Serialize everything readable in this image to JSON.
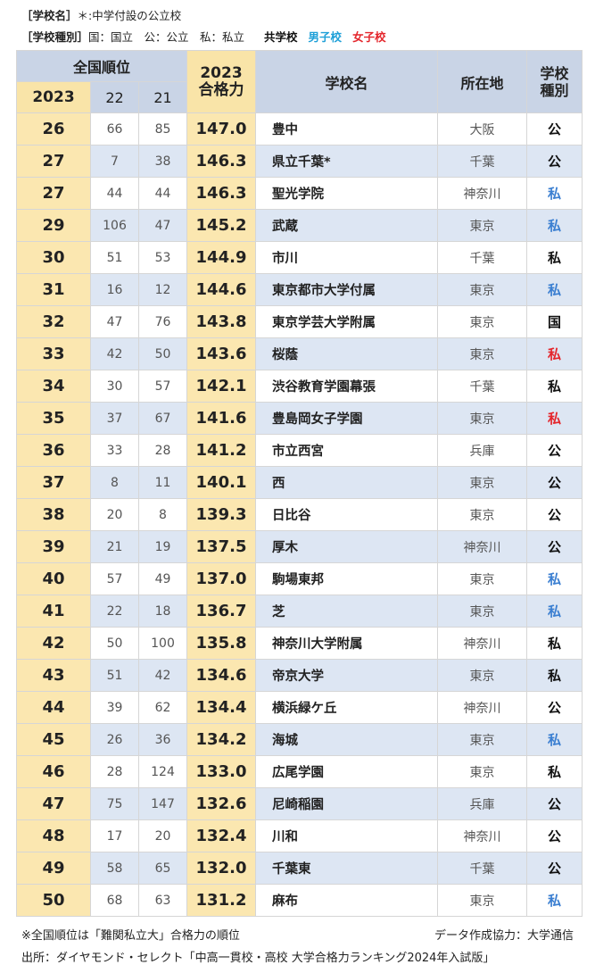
{
  "legend": {
    "line1_label": "［学校名］",
    "line1_text": "＊:中学付設の公立校",
    "line2_label": "［学校種別］",
    "line2_text": "国：国立　公：公立　私：私立",
    "coed": "共学校",
    "boys": "男子校",
    "girls": "女子校"
  },
  "header": {
    "national_rank": "全国順位",
    "y2023": "2023",
    "y22": "22",
    "y21": "21",
    "power_year": "2023",
    "power_label": "合格力",
    "school_name": "学校名",
    "location": "所在地",
    "school_type": "学校種別"
  },
  "type_colors": {
    "coed": "#111111",
    "boys": "#3b7fd1",
    "girls": "#e4262c"
  },
  "rows": [
    {
      "r23": "26",
      "r22": "66",
      "r21": "85",
      "power": "147.0",
      "name": "豊中",
      "loc": "大阪",
      "type": "公",
      "cat": "coed"
    },
    {
      "r23": "27",
      "r22": "7",
      "r21": "38",
      "power": "146.3",
      "name": "県立千葉*",
      "loc": "千葉",
      "type": "公",
      "cat": "coed"
    },
    {
      "r23": "27",
      "r22": "44",
      "r21": "44",
      "power": "146.3",
      "name": "聖光学院",
      "loc": "神奈川",
      "type": "私",
      "cat": "boys"
    },
    {
      "r23": "29",
      "r22": "106",
      "r21": "47",
      "power": "145.2",
      "name": "武蔵",
      "loc": "東京",
      "type": "私",
      "cat": "boys"
    },
    {
      "r23": "30",
      "r22": "51",
      "r21": "53",
      "power": "144.9",
      "name": "市川",
      "loc": "千葉",
      "type": "私",
      "cat": "coed"
    },
    {
      "r23": "31",
      "r22": "16",
      "r21": "12",
      "power": "144.6",
      "name": "東京都市大学付属",
      "loc": "東京",
      "type": "私",
      "cat": "boys"
    },
    {
      "r23": "32",
      "r22": "47",
      "r21": "76",
      "power": "143.8",
      "name": "東京学芸大学附属",
      "loc": "東京",
      "type": "国",
      "cat": "coed"
    },
    {
      "r23": "33",
      "r22": "42",
      "r21": "50",
      "power": "143.6",
      "name": "桜蔭",
      "loc": "東京",
      "type": "私",
      "cat": "girls"
    },
    {
      "r23": "34",
      "r22": "30",
      "r21": "57",
      "power": "142.1",
      "name": "渋谷教育学園幕張",
      "loc": "千葉",
      "type": "私",
      "cat": "coed"
    },
    {
      "r23": "35",
      "r22": "37",
      "r21": "67",
      "power": "141.6",
      "name": "豊島岡女子学園",
      "loc": "東京",
      "type": "私",
      "cat": "girls"
    },
    {
      "r23": "36",
      "r22": "33",
      "r21": "28",
      "power": "141.2",
      "name": "市立西宮",
      "loc": "兵庫",
      "type": "公",
      "cat": "coed"
    },
    {
      "r23": "37",
      "r22": "8",
      "r21": "11",
      "power": "140.1",
      "name": "西",
      "loc": "東京",
      "type": "公",
      "cat": "coed"
    },
    {
      "r23": "38",
      "r22": "20",
      "r21": "8",
      "power": "139.3",
      "name": "日比谷",
      "loc": "東京",
      "type": "公",
      "cat": "coed"
    },
    {
      "r23": "39",
      "r22": "21",
      "r21": "19",
      "power": "137.5",
      "name": "厚木",
      "loc": "神奈川",
      "type": "公",
      "cat": "coed"
    },
    {
      "r23": "40",
      "r22": "57",
      "r21": "49",
      "power": "137.0",
      "name": "駒場東邦",
      "loc": "東京",
      "type": "私",
      "cat": "boys"
    },
    {
      "r23": "41",
      "r22": "22",
      "r21": "18",
      "power": "136.7",
      "name": "芝",
      "loc": "東京",
      "type": "私",
      "cat": "boys"
    },
    {
      "r23": "42",
      "r22": "50",
      "r21": "100",
      "power": "135.8",
      "name": "神奈川大学附属",
      "loc": "神奈川",
      "type": "私",
      "cat": "coed"
    },
    {
      "r23": "43",
      "r22": "51",
      "r21": "42",
      "power": "134.6",
      "name": "帝京大学",
      "loc": "東京",
      "type": "私",
      "cat": "coed"
    },
    {
      "r23": "44",
      "r22": "39",
      "r21": "62",
      "power": "134.4",
      "name": "横浜緑ケ丘",
      "loc": "神奈川",
      "type": "公",
      "cat": "coed"
    },
    {
      "r23": "45",
      "r22": "26",
      "r21": "36",
      "power": "134.2",
      "name": "海城",
      "loc": "東京",
      "type": "私",
      "cat": "boys"
    },
    {
      "r23": "46",
      "r22": "28",
      "r21": "124",
      "power": "133.0",
      "name": "広尾学園",
      "loc": "東京",
      "type": "私",
      "cat": "coed"
    },
    {
      "r23": "47",
      "r22": "75",
      "r21": "147",
      "power": "132.6",
      "name": "尼崎稲園",
      "loc": "兵庫",
      "type": "公",
      "cat": "coed"
    },
    {
      "r23": "48",
      "r22": "17",
      "r21": "20",
      "power": "132.4",
      "name": "川和",
      "loc": "神奈川",
      "type": "公",
      "cat": "coed"
    },
    {
      "r23": "49",
      "r22": "58",
      "r21": "65",
      "power": "132.0",
      "name": "千葉東",
      "loc": "千葉",
      "type": "公",
      "cat": "coed"
    },
    {
      "r23": "50",
      "r22": "68",
      "r21": "63",
      "power": "131.2",
      "name": "麻布",
      "loc": "東京",
      "type": "私",
      "cat": "boys"
    }
  ],
  "footer": {
    "note": "※全国順位は「難関私立大」合格力の順位",
    "credit": "データ作成協力：大学通信",
    "source": "出所：ダイヤモンド・セレクト「中高一貫校・高校 大学合格力ランキング2024年入試版」"
  }
}
